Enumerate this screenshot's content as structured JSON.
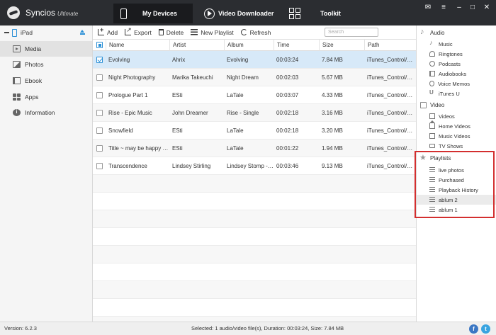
{
  "app": {
    "name": "Syncios",
    "edition": "Ultimate"
  },
  "nav": {
    "tabs": [
      {
        "label": "My Devices",
        "icon": "phone-icon"
      },
      {
        "label": "Video Downloader",
        "icon": "play-circle-icon"
      },
      {
        "label": "Toolkit",
        "icon": "grid-icon"
      }
    ]
  },
  "window_controls": {
    "msg": "✉",
    "menu": "≡",
    "min": "–",
    "max": "□",
    "close": "✕"
  },
  "sidebar": {
    "device": "iPad",
    "items": [
      {
        "label": "Media",
        "icon": "media-icon"
      },
      {
        "label": "Photos",
        "icon": "photos-icon"
      },
      {
        "label": "Ebook",
        "icon": "ebook-icon"
      },
      {
        "label": "Apps",
        "icon": "apps-icon"
      },
      {
        "label": "Information",
        "icon": "info-icon"
      }
    ]
  },
  "toolbar": {
    "add": "Add",
    "export": "Export",
    "delete": "Delete",
    "new_playlist": "New Playlist",
    "refresh": "Refresh",
    "search_placeholder": "Search"
  },
  "table": {
    "columns": [
      "Name",
      "Artist",
      "Album",
      "Time",
      "Size",
      "Path"
    ],
    "rows": [
      {
        "name": "Evolving",
        "artist": "Ahrix",
        "album": "Evolving",
        "time": "00:03:24",
        "size": "7.84 MB",
        "path": "iTunes_Control/M..."
      },
      {
        "name": "Night Photography",
        "artist": "Marika Takeuchi",
        "album": "Night Dream",
        "time": "00:02:03",
        "size": "5.67 MB",
        "path": "iTunes_Control/M..."
      },
      {
        "name": "Prologue Part 1",
        "artist": "ESti",
        "album": "LaTale",
        "time": "00:03:07",
        "size": "4.33 MB",
        "path": "iTunes_Control/M..."
      },
      {
        "name": "Rise - Epic Music",
        "artist": "John Dreamer",
        "album": "Rise - Single",
        "time": "00:02:18",
        "size": "3.16 MB",
        "path": "iTunes_Control/M..."
      },
      {
        "name": "Snowfield",
        "artist": "ESti",
        "album": "LaTale",
        "time": "00:02:18",
        "size": "3.20 MB",
        "path": "iTunes_Control/M..."
      },
      {
        "name": "Title ~ may be happy fo...",
        "artist": "ESti",
        "album": "LaTale",
        "time": "00:01:22",
        "size": "1.94 MB",
        "path": "iTunes_Control/M..."
      },
      {
        "name": "Transcendence",
        "artist": "Lindsey Stirling",
        "album": "Lindsey Stomp - EP",
        "time": "00:03:46",
        "size": "9.13 MB",
        "path": "iTunes_Control/M..."
      }
    ]
  },
  "right_panel": {
    "audio": {
      "label": "Audio",
      "items": [
        "Music",
        "Ringtones",
        "Podcasts",
        "Audiobooks",
        "Voice Memos",
        "iTunes U"
      ]
    },
    "video": {
      "label": "Video",
      "items": [
        "Videos",
        "Home Videos",
        "Music Videos",
        "TV Shows"
      ]
    },
    "playlists": {
      "label": "Playlists",
      "items": [
        "live photos",
        "Purchased",
        "Playback History",
        "ablum 2",
        "ablum 1"
      ]
    }
  },
  "status": {
    "version": "Version: 6.2.3",
    "summary": "Selected: 1 audio/video file(s), Duration: 00:03:24, Size: 7.84 MB"
  },
  "social": {
    "facebook": "f",
    "twitter": "t"
  },
  "colors": {
    "accent": "#2a8fd6",
    "highlight_box": "#d32f2f",
    "topbar": "#2b2d31"
  }
}
